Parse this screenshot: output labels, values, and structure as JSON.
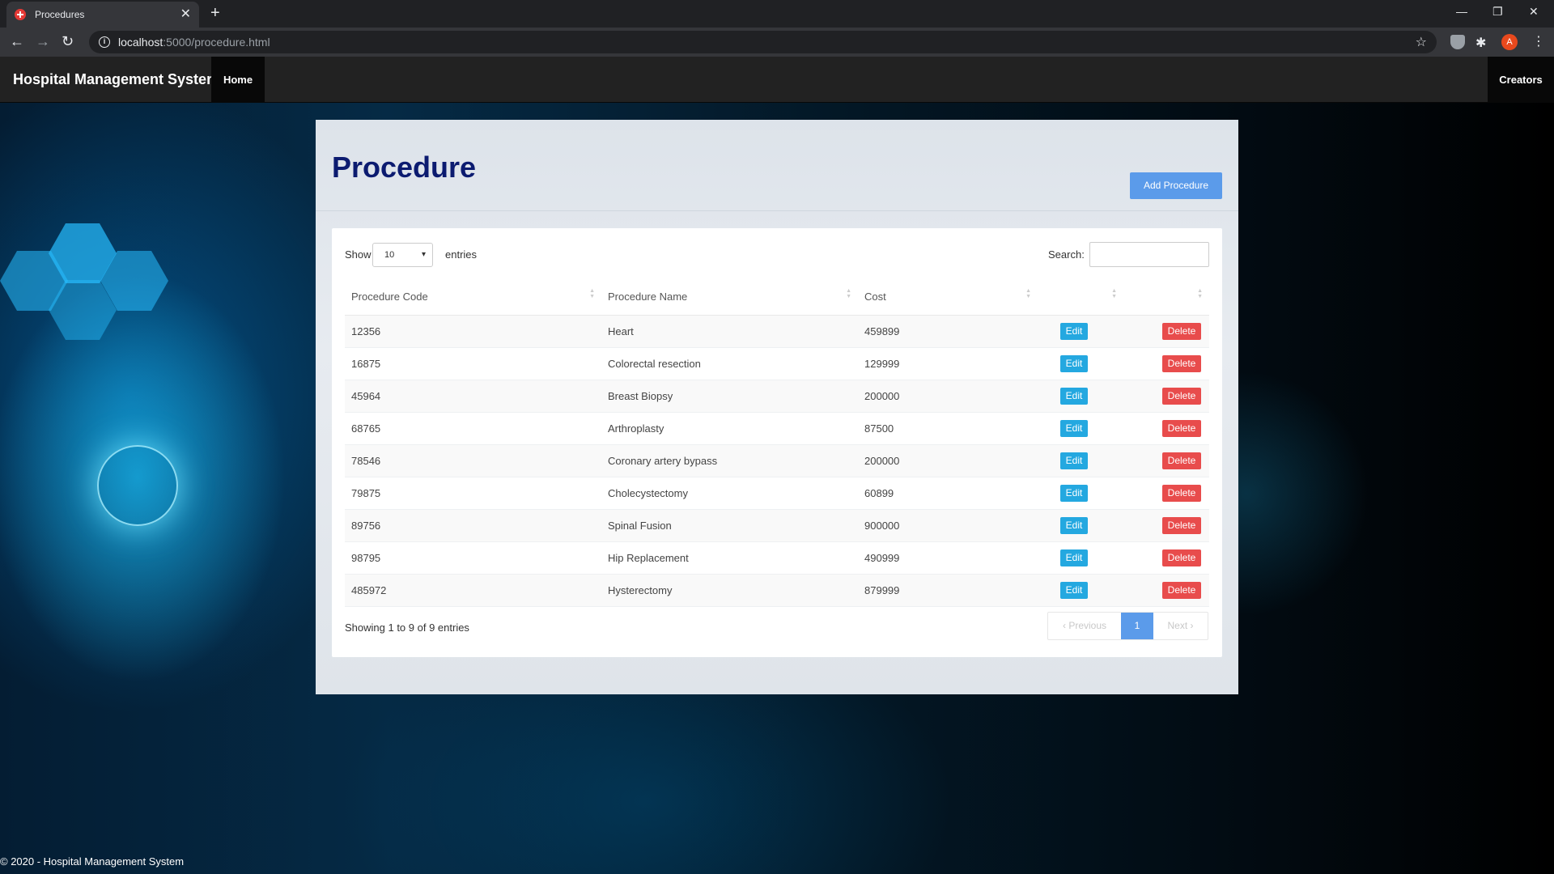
{
  "browser": {
    "tab_title": "Procedures",
    "url_host": "localhost",
    "url_path": ":5000/procedure.html",
    "avatar_letter": "A",
    "colors": {
      "tabbar": "#202124",
      "toolbar": "#35363a",
      "avatar": "#e8491d"
    }
  },
  "navbar": {
    "brand": "Hospital Management System",
    "home_label": "Home",
    "creators_label": "Creators"
  },
  "panel": {
    "title": "Procedure",
    "add_button": "Add Procedure"
  },
  "table_controls": {
    "show_label": "Show",
    "page_length": "10",
    "entries_label": "entries",
    "search_label": "Search:",
    "search_value": ""
  },
  "table": {
    "headers": [
      "Procedure Code",
      "Procedure Name",
      "Cost",
      "",
      ""
    ],
    "edit_label": "Edit",
    "delete_label": "Delete",
    "rows": [
      {
        "code": "12356",
        "name": "Heart",
        "cost": "459899"
      },
      {
        "code": "16875",
        "name": "Colorectal resection",
        "cost": "129999"
      },
      {
        "code": "45964",
        "name": "Breast Biopsy",
        "cost": "200000"
      },
      {
        "code": "68765",
        "name": "Arthroplasty",
        "cost": "87500"
      },
      {
        "code": "78546",
        "name": "Coronary artery bypass",
        "cost": "200000"
      },
      {
        "code": "79875",
        "name": "Cholecystectomy",
        "cost": "60899"
      },
      {
        "code": "89756",
        "name": "Spinal Fusion",
        "cost": "900000"
      },
      {
        "code": "98795",
        "name": "Hip Replacement",
        "cost": "490999"
      },
      {
        "code": "485972",
        "name": "Hysterectomy",
        "cost": "879999"
      }
    ]
  },
  "pagination": {
    "info": "Showing 1 to 9 of 9 entries",
    "previous": "Previous",
    "current": "1",
    "next": "Next"
  },
  "footer": {
    "text": "© 2020 - Hospital Management System"
  },
  "colors": {
    "title": "#0c1b70",
    "primary_button": "#5b9bea",
    "edit_button": "#24a8e0",
    "delete_button": "#e84c4c",
    "navbar": "#222222"
  }
}
